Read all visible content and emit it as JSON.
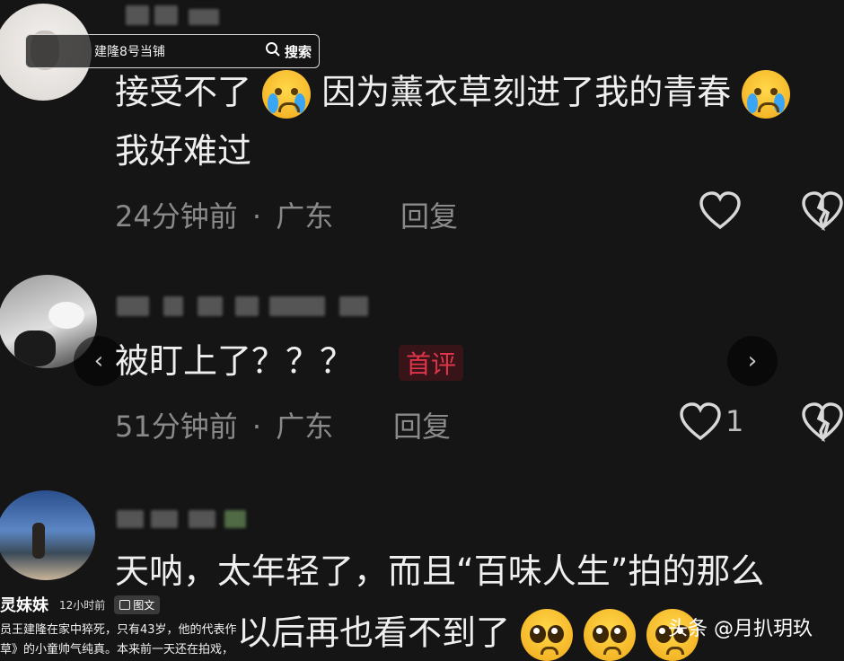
{
  "search": {
    "query": "建隆8号当铺",
    "button_label": "搜索"
  },
  "comments": [
    {
      "text_line1": "接受不了",
      "text_line1b": "因为薰衣草刻进了我的青春",
      "text_line2": "我好难过",
      "time": "24分钟前",
      "sep": "·",
      "location": "广东",
      "reply_label": "回复"
    },
    {
      "text": "被盯上了？？？",
      "badge": "首评",
      "time": "51分钟前",
      "sep": "·",
      "location": "广东",
      "reply_label": "回复",
      "like_count": "1"
    },
    {
      "text_line1": "天呐，太年轻了，而且“百味人生”拍的那么",
      "text_line2": "以后再也看不到了"
    }
  ],
  "footer": {
    "author": "灵妹妹",
    "time": "12小时前",
    "tag": "图文",
    "caption_line1": "员王建隆在家中猝死，只有43岁，他的代表作",
    "caption_line2": "草》的小童帅气纯真。本来前一天还在拍戏，",
    "watermark": "头条 @月扒玥玖"
  },
  "icons": [
    "search-icon",
    "heart-icon",
    "dislike-heart-icon",
    "chevron-left-icon",
    "chevron-right-icon",
    "crying-emoji-icon",
    "pleading-emoji-icon"
  ]
}
